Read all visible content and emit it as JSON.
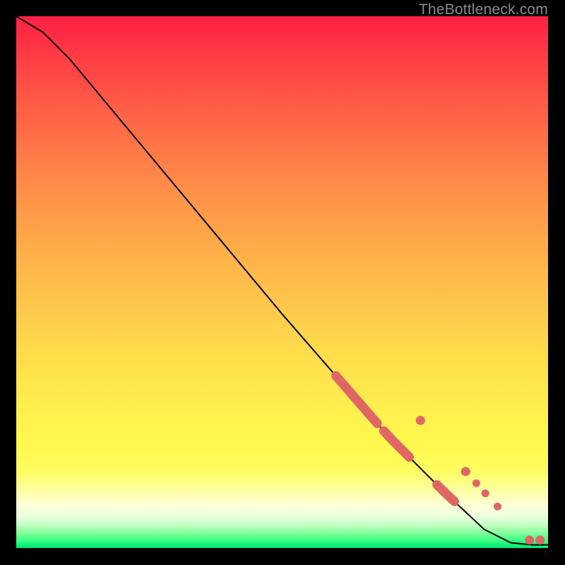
{
  "watermark": "TheBottleneck.com",
  "chart_data": {
    "type": "line",
    "title": "",
    "xlabel": "",
    "ylabel": "",
    "xlim": [
      0,
      100
    ],
    "ylim": [
      0,
      100
    ],
    "grid": false,
    "curve_points": [
      {
        "x": 0,
        "y": 100
      },
      {
        "x": 5,
        "y": 97
      },
      {
        "x": 10,
        "y": 92
      },
      {
        "x": 15,
        "y": 86
      },
      {
        "x": 20,
        "y": 80
      },
      {
        "x": 30,
        "y": 68
      },
      {
        "x": 40,
        "y": 56
      },
      {
        "x": 50,
        "y": 44
      },
      {
        "x": 60,
        "y": 32.5
      },
      {
        "x": 70,
        "y": 21
      },
      {
        "x": 80,
        "y": 11
      },
      {
        "x": 88,
        "y": 3.5
      },
      {
        "x": 93,
        "y": 1
      },
      {
        "x": 97,
        "y": 0.6
      },
      {
        "x": 100,
        "y": 0.6
      }
    ],
    "markers_large": [
      {
        "x": 61,
        "y": 41.0
      },
      {
        "x": 62.5,
        "y": 39.3
      },
      {
        "x": 64,
        "y": 37.6
      },
      {
        "x": 65.5,
        "y": 35.9
      },
      {
        "x": 67,
        "y": 34.2
      },
      {
        "x": 70,
        "y": 30.8
      },
      {
        "x": 71.5,
        "y": 29.1
      },
      {
        "x": 73,
        "y": 27.4
      },
      {
        "x": 80,
        "y": 19.5
      },
      {
        "x": 81.5,
        "y": 17.8
      }
    ],
    "markers_round": [
      {
        "x": 76,
        "y": 24.0,
        "r": 6.5
      },
      {
        "x": 84.5,
        "y": 14.4,
        "r": 6.5
      },
      {
        "x": 86.5,
        "y": 12.2,
        "r": 5.5
      },
      {
        "x": 88.2,
        "y": 10.3,
        "r": 5.5
      },
      {
        "x": 90.5,
        "y": 7.8,
        "r": 5.5
      },
      {
        "x": 96.5,
        "y": 1.5,
        "r": 6.5
      },
      {
        "x": 98.5,
        "y": 1.5,
        "r": 6.5
      }
    ],
    "colors": {
      "curve": "#000000",
      "marker": "#e06666"
    }
  }
}
